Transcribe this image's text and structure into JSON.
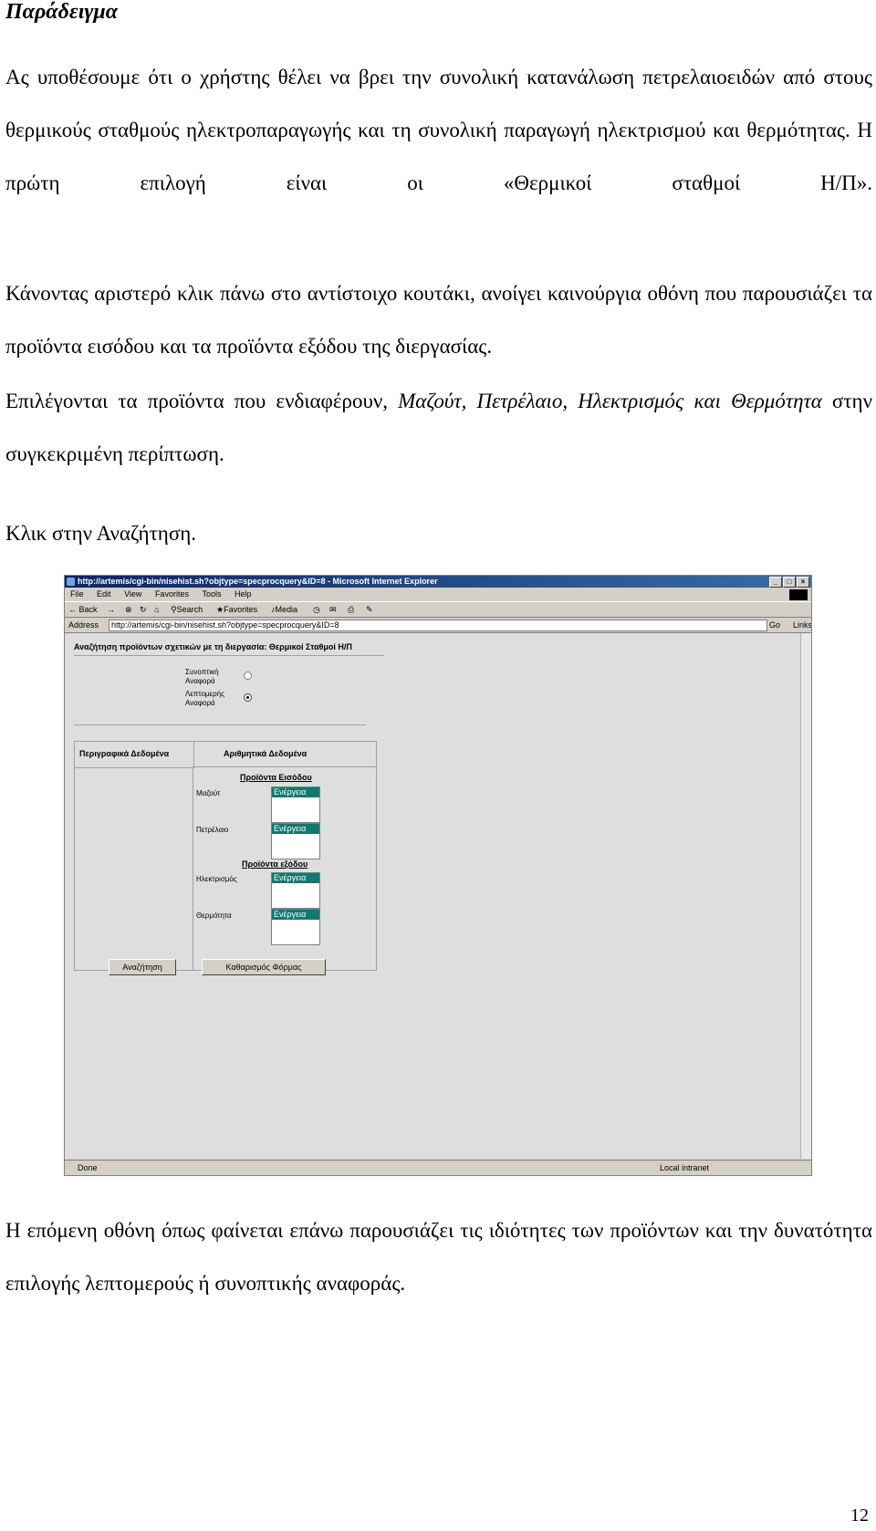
{
  "doc": {
    "heading": "Παράδειγμα",
    "p1": "Ας υποθέσουμε ότι ο χρήστης θέλει να βρει την συνολική κατανάλωση πετρελαιοειδών από στους θερμικούς σταθμούς ηλεκτροπαραγωγής και τη συνολική παραγωγή ηλεκτρισμού και θερμότητας. Η πρώτη επιλογή είναι οι «Θερμικοί σταθμοί Η/Π».",
    "p2": "Κάνοντας αριστερό κλικ πάνω στο αντίστοιχο κουτάκι, ανοίγει καινούργια οθόνη που παρουσιάζει τα προϊόντα εισόδου και τα προϊόντα εξόδου της διεργασίας.",
    "p3_start": "Επιλέγονται τα προϊόντα που ενδιαφέρουν, ",
    "p3_italic": "Μαζούτ, Πετρέλαιο, Ηλεκτρισμός και Θερμότητα",
    "p3_end": " στην συγκεκριμένη περίπτωση.",
    "p4": "Κλικ στην Αναζήτηση.",
    "p5": "Η επόμενη οθόνη όπως φαίνεται επάνω παρουσιάζει τις ιδιότητες των προϊόντων και την δυνατότητα επιλογής λεπτομερούς ή συνοπτικής αναφοράς.",
    "page_number": "12"
  },
  "browser": {
    "title": "http://artemis/cgi-bin/nisehist.sh?objtype=specprocquery&ID=8 - Microsoft Internet Explorer",
    "window_buttons": [
      "_",
      "□",
      "×"
    ],
    "menu": [
      "File",
      "Edit",
      "View",
      "Favorites",
      "Tools",
      "Help"
    ],
    "toolbar": {
      "back": "← Back",
      "forward": "→",
      "stop": "⊗",
      "refresh": "↻",
      "home": "⌂",
      "search": "Search",
      "favorites": "Favorites",
      "media": "Media",
      "history": "◷"
    },
    "address_label": "Address",
    "address_url": "http://artemis/cgi-bin/nisehist.sh?objtype=specprocquery&ID=8",
    "go_label": "Go",
    "links_label": "Links",
    "status_left": "Done",
    "status_right": "Local intranet",
    "icons": [
      "ie-logo-icon",
      "back-arrow-icon",
      "search-icon",
      "favorites-icon",
      "media-icon",
      "history-icon",
      "mail-icon",
      "print-icon",
      "edit-icon"
    ]
  },
  "form": {
    "title": "Αναζήτηση προϊόντων σχετικών με τη διεργασία: Θερμικοί Σταθμοί Η/Π",
    "radio_summary_line1": "Συνοπτική",
    "radio_summary_line2": "Αναφορά",
    "radio_detail_line1": "Λεπτομερής",
    "radio_detail_line2": "Αναφορά",
    "selected_report": "Λεπτομερής Αναφορά",
    "col_descriptive": "Περιγραφικά Δεδομένα",
    "col_numeric": "Αριθμητικά Δεδομένα",
    "inputs_header": "Προϊόντα Εισόδου",
    "outputs_header": "Προϊόντα εξόδου",
    "products": [
      {
        "name": "Μαζούτ",
        "option": "Ενέργεια"
      },
      {
        "name": "Πετρέλαιο",
        "option": "Ενέργεια"
      },
      {
        "name": "Ηλεκτρισμός",
        "option": "Ενέργεια"
      },
      {
        "name": "Θερμότητα",
        "option": "Ενέργεια"
      }
    ],
    "search_button": "Αναζήτηση",
    "clear_button": "Καθαρισμός Φόρμας"
  }
}
